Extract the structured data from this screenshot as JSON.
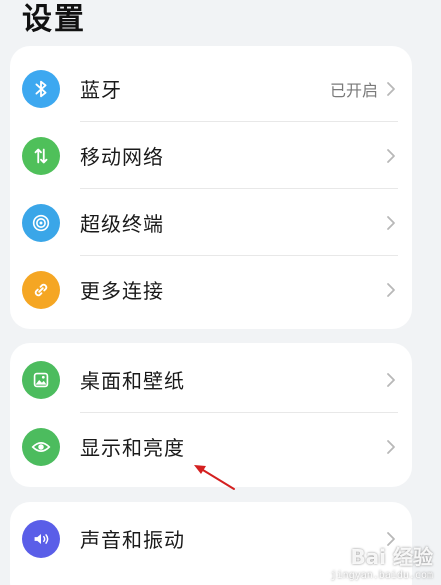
{
  "header": {
    "title": "设置"
  },
  "groups": [
    {
      "items": [
        {
          "label": "蓝牙",
          "value": "已开启",
          "icon": "bluetooth-icon",
          "color": "#3da8f0"
        },
        {
          "label": "移动网络",
          "value": "",
          "icon": "mobile-data-icon",
          "color": "#4fc05a"
        },
        {
          "label": "超级终端",
          "value": "",
          "icon": "super-device-icon",
          "color": "#3aa6e8"
        },
        {
          "label": "更多连接",
          "value": "",
          "icon": "link-icon",
          "color": "#f5a623"
        }
      ]
    },
    {
      "items": [
        {
          "label": "桌面和壁纸",
          "value": "",
          "icon": "wallpaper-icon",
          "color": "#4cbc5e"
        },
        {
          "label": "显示和亮度",
          "value": "",
          "icon": "eye-icon",
          "color": "#4cbc5e"
        }
      ]
    },
    {
      "items": [
        {
          "label": "声音和振动",
          "value": "",
          "icon": "sound-icon",
          "color": "#5a5ee8"
        }
      ]
    }
  ],
  "annotation": {
    "arrow_color": "#d42020"
  },
  "watermark": {
    "main": "Bai 经验",
    "sub": "jingyan.baidu.com"
  }
}
